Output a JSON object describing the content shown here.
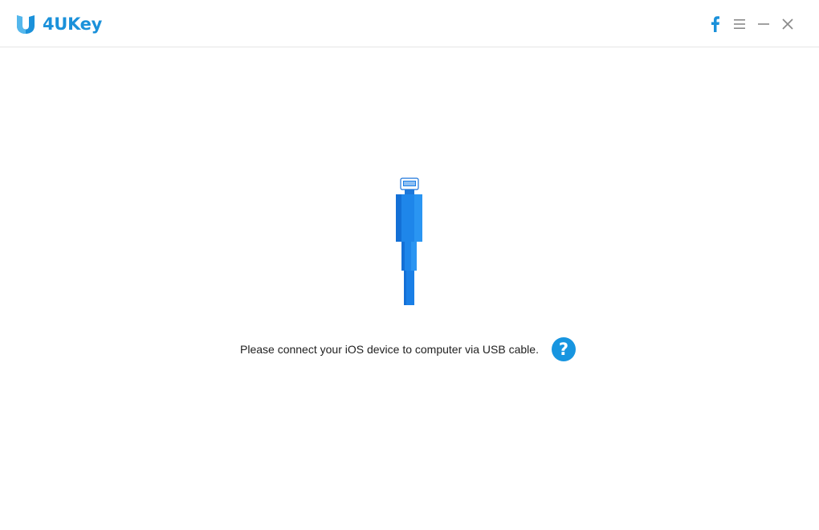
{
  "app": {
    "name": "4UKey",
    "brand_color": "#1b91da"
  },
  "titlebar": {
    "facebook_icon": "facebook-icon",
    "menu_icon": "menu-icon",
    "minimize_icon": "minimize-icon",
    "close_icon": "close-icon"
  },
  "main": {
    "illustration_icon": "lightning-cable-icon",
    "message": "Please connect your iOS device to computer via USB cable.",
    "help_icon": "question-icon",
    "help_label": "?"
  }
}
